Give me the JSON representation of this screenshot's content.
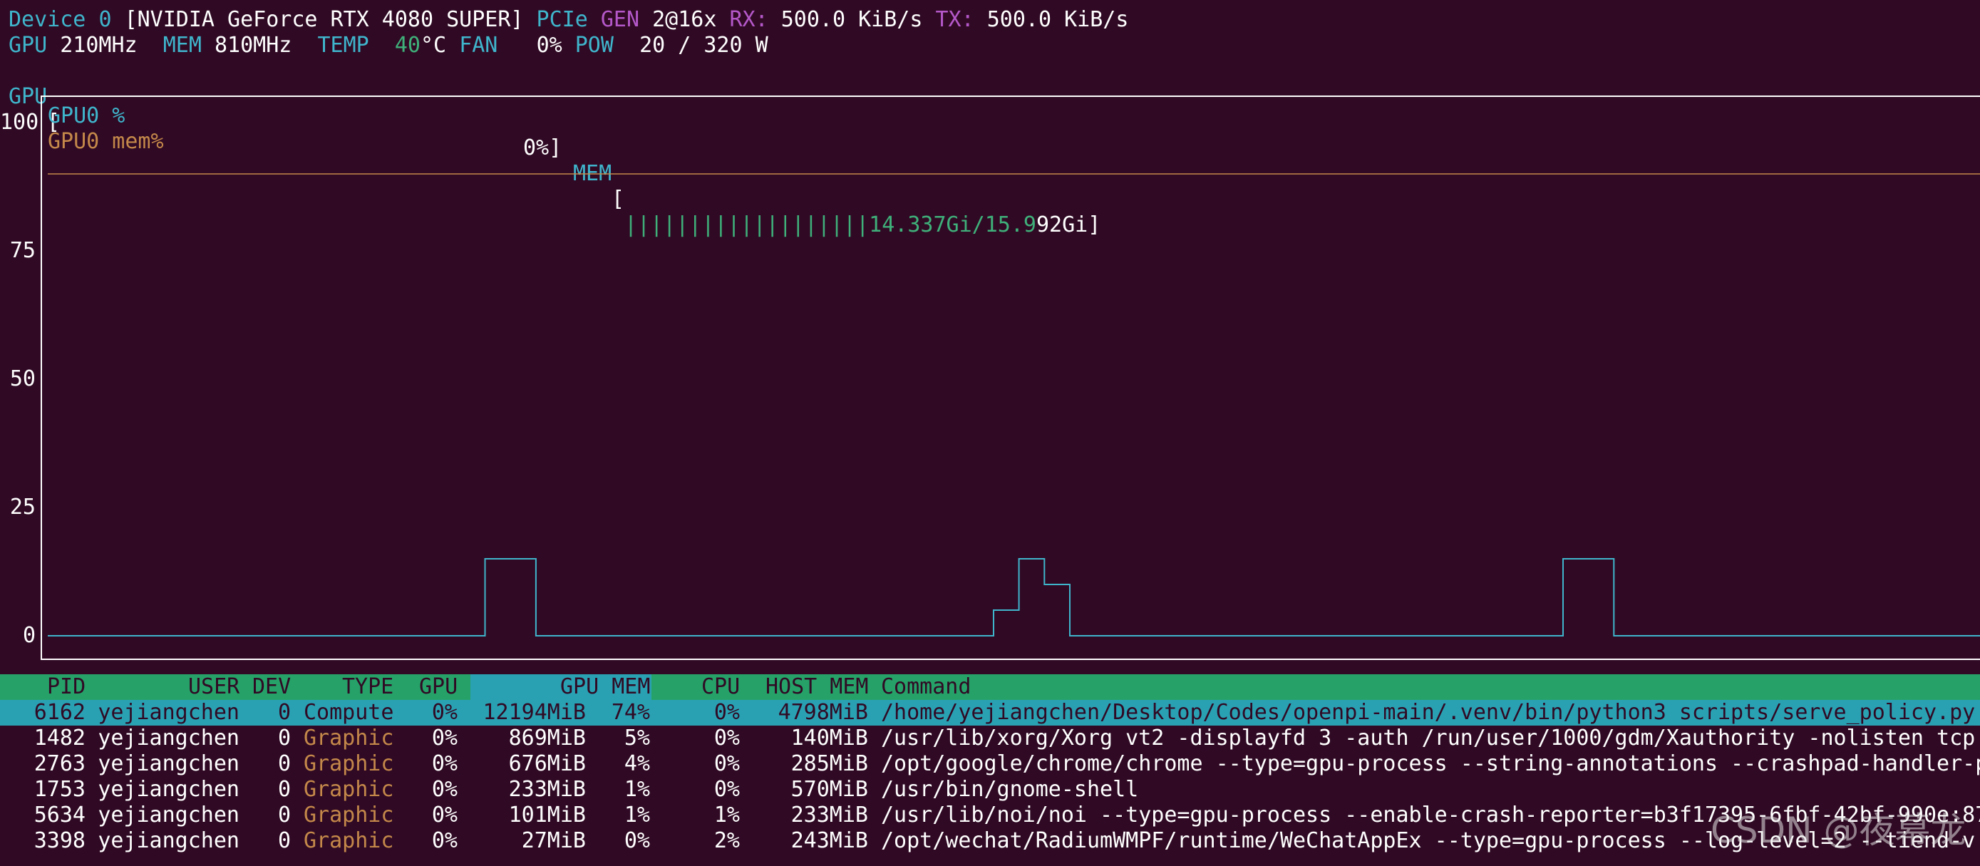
{
  "device": {
    "device_label": "Device",
    "device_index": "0",
    "name": "[NVIDIA GeForce RTX 4080 SUPER]",
    "pcie_label": "PCIe",
    "gen_label": "GEN",
    "gen_value": "2@16x",
    "rx_label": "RX:",
    "rx_value": "500.0 KiB/s",
    "tx_label": "TX:",
    "tx_value": "500.0 KiB/s"
  },
  "stats": {
    "gpu_label": "GPU",
    "gpu_clock": "210MHz",
    "mem_label": "MEM",
    "mem_clock": "810MHz",
    "temp_label": "TEMP",
    "temp_value": "40",
    "temp_unit": "°C",
    "fan_label": "FAN",
    "fan_value": "0%",
    "pow_label": "POW",
    "pow_value": "20 / 320 W"
  },
  "bars": {
    "gpu_label": "GPU",
    "gpu_open": "[",
    "gpu_value": "0%]",
    "mem_label": "MEM",
    "mem_open": "[",
    "mem_bars": "|||||||||||||||||||",
    "mem_text_green": "14.337Gi/15.9",
    "mem_text_white": "92Gi]"
  },
  "chart_data": {
    "type": "line",
    "ylim": [
      0,
      100
    ],
    "yticks": [
      "100",
      "75",
      "50",
      "25",
      "0"
    ],
    "grid": false,
    "legend_position": "top-left",
    "series": [
      {
        "name": "GPU0 %",
        "color": "#3fb5cc",
        "step": true,
        "x": [
          0,
          86,
          86,
          96,
          96,
          186,
          186,
          191,
          191,
          196,
          196,
          201,
          201,
          298,
          298,
          308,
          308,
          380
        ],
        "values": [
          0,
          0,
          15,
          15,
          0,
          0,
          5,
          5,
          15,
          15,
          10,
          10,
          0,
          0,
          15,
          15,
          0,
          0
        ]
      },
      {
        "name": "GPU0 mem%",
        "color": "#c4884a",
        "step": false,
        "x": [
          0,
          380
        ],
        "values": [
          90,
          90
        ]
      }
    ]
  },
  "process_table": {
    "headers": {
      "pid": "PID",
      "user": "USER",
      "dev": "DEV",
      "type": "TYPE",
      "gpu": "GPU",
      "gpu_mem": "GPU MEM",
      "cpu": "CPU",
      "host_mem": "HOST MEM",
      "command": "Command"
    },
    "rows": [
      {
        "pid": "6162",
        "user": "yejiangchen",
        "dev": "0",
        "type": "Compute",
        "gpu": "0%",
        "gpu_mem": "12194MiB",
        "gpu_mem_pct": "74%",
        "cpu": "0%",
        "host_mem": "4798MiB",
        "command": "/home/yejiangchen/Desktop/Codes/openpi-main/.venv/bin/python3 scripts/serve_policy.py"
      },
      {
        "pid": "1482",
        "user": "yejiangchen",
        "dev": "0",
        "type": "Graphic",
        "gpu": "0%",
        "gpu_mem": "869MiB",
        "gpu_mem_pct": "5%",
        "cpu": "0%",
        "host_mem": "140MiB",
        "command": "/usr/lib/xorg/Xorg vt2 -displayfd 3 -auth /run/user/1000/gdm/Xauthority -nolisten tcp"
      },
      {
        "pid": "2763",
        "user": "yejiangchen",
        "dev": "0",
        "type": "Graphic",
        "gpu": "0%",
        "gpu_mem": "676MiB",
        "gpu_mem_pct": "4%",
        "cpu": "0%",
        "host_mem": "285MiB",
        "command": "/opt/google/chrome/chrome --type=gpu-process --string-annotations --crashpad-handler-p"
      },
      {
        "pid": "1753",
        "user": "yejiangchen",
        "dev": "0",
        "type": "Graphic",
        "gpu": "0%",
        "gpu_mem": "233MiB",
        "gpu_mem_pct": "1%",
        "cpu": "0%",
        "host_mem": "570MiB",
        "command": "/usr/bin/gnome-shell"
      },
      {
        "pid": "5634",
        "user": "yejiangchen",
        "dev": "0",
        "type": "Graphic",
        "gpu": "0%",
        "gpu_mem": "101MiB",
        "gpu_mem_pct": "1%",
        "cpu": "1%",
        "host_mem": "233MiB",
        "command": "/usr/lib/noi/noi --type=gpu-process --enable-crash-reporter=b3f17395-6fbf-42bf-990e:87"
      },
      {
        "pid": "3398",
        "user": "yejiangchen",
        "dev": "0",
        "type": "Graphic",
        "gpu": "0%",
        "gpu_mem": "27MiB",
        "gpu_mem_pct": "0%",
        "cpu": "2%",
        "host_mem": "243MiB",
        "command": "/opt/wechat/RadiumWMPF/runtime/WeChatAppEx --type=gpu-process --log-level=2 --tiend-v"
      }
    ]
  },
  "watermark": "CSDN @夜幕龙"
}
